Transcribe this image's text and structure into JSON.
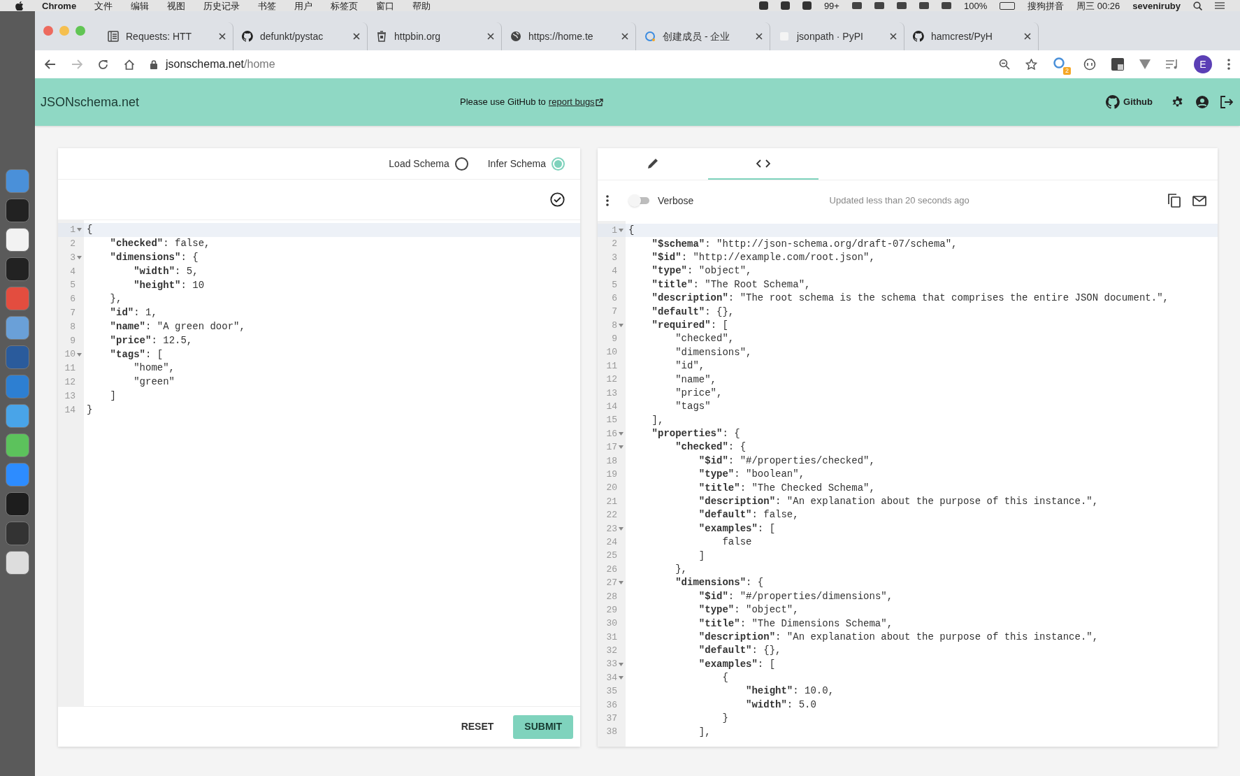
{
  "menu_bar": {
    "app": "Chrome",
    "menus": [
      "文件",
      "编辑",
      "视图",
      "历史记录",
      "书签",
      "用户",
      "标签页",
      "窗口",
      "帮助"
    ],
    "status_items": [
      "99+",
      "100%",
      "搜狗拼音",
      "周三 00:26",
      "seveniruby"
    ]
  },
  "browser": {
    "tabs": [
      {
        "title": "Requests: HTT",
        "kind": "doc",
        "selected": false
      },
      {
        "title": "defunkt/pystac",
        "kind": "github",
        "selected": false
      },
      {
        "title": "httpbin.org",
        "kind": "bin",
        "selected": false
      },
      {
        "title": "https://home.te",
        "kind": "globe",
        "selected": false
      },
      {
        "title": "创建成员 - 企业",
        "kind": "ring",
        "selected": false
      },
      {
        "title": "jsonpath · PyPI",
        "kind": "blank",
        "selected": false
      },
      {
        "title": "hamcrest/PyH",
        "kind": "github",
        "selected": false
      }
    ],
    "address": {
      "host": "jsonschema.net",
      "path": "/home"
    },
    "extension_badge": "2",
    "avatar": "E"
  },
  "app_header": {
    "brand": "JSONschema.net",
    "notice": "Please use GitHub to",
    "notice_link": "report bugs",
    "github_label": "Github"
  },
  "input_panel": {
    "options": [
      {
        "label": "Load Schema",
        "selected": false
      },
      {
        "label": "Infer Schema",
        "selected": true
      }
    ],
    "lines": [
      {
        "n": "1",
        "text": "{",
        "fold": true,
        "active": true
      },
      {
        "n": "2",
        "text": "    **\"checked\"**: false,",
        "fold": false,
        "active": false
      },
      {
        "n": "3",
        "text": "    **\"dimensions\"**: {",
        "fold": true,
        "active": false
      },
      {
        "n": "4",
        "text": "        **\"width\"**: 5,",
        "fold": false,
        "active": false
      },
      {
        "n": "5",
        "text": "        **\"height\"**: 10",
        "fold": false,
        "active": false
      },
      {
        "n": "6",
        "text": "    },",
        "fold": false,
        "active": false
      },
      {
        "n": "7",
        "text": "    **\"id\"**: 1,",
        "fold": false,
        "active": false
      },
      {
        "n": "8",
        "text": "    **\"name\"**: \"A green door\",",
        "fold": false,
        "active": false
      },
      {
        "n": "9",
        "text": "    **\"price\"**: 12.5,",
        "fold": false,
        "active": false
      },
      {
        "n": "10",
        "text": "    **\"tags\"**: [",
        "fold": true,
        "active": false
      },
      {
        "n": "11",
        "text": "        \"home\",",
        "fold": false,
        "active": false
      },
      {
        "n": "12",
        "text": "        \"green\"",
        "fold": false,
        "active": false
      },
      {
        "n": "13",
        "text": "    ]",
        "fold": false,
        "active": false
      },
      {
        "n": "14",
        "text": "}",
        "fold": false,
        "active": false
      }
    ],
    "buttons": [
      {
        "label": "RESET",
        "kind": "text"
      },
      {
        "label": "SUBMIT",
        "kind": "primary"
      }
    ]
  },
  "schema_panel": {
    "tabs": [
      {
        "kind": "edit",
        "selected": false
      },
      {
        "kind": "code",
        "selected": true
      }
    ],
    "verbose": {
      "label": "Verbose",
      "on": false
    },
    "status": "Updated less than 20 seconds ago",
    "lines": [
      {
        "n": "1",
        "text": "{",
        "fold": true,
        "active": true
      },
      {
        "n": "2",
        "text": "    **\"$schema\"**: \"http://json-schema.org/draft-07/schema\",",
        "fold": false,
        "active": false
      },
      {
        "n": "3",
        "text": "    **\"$id\"**: \"http://example.com/root.json\",",
        "fold": false,
        "active": false
      },
      {
        "n": "4",
        "text": "    **\"type\"**: \"object\",",
        "fold": false,
        "active": false
      },
      {
        "n": "5",
        "text": "    **\"title\"**: \"The Root Schema\",",
        "fold": false,
        "active": false
      },
      {
        "n": "6",
        "text": "    **\"description\"**: \"The root schema is the schema that comprises the entire JSON document.\",",
        "fold": false,
        "active": false
      },
      {
        "n": "7",
        "text": "    **\"default\"**: {},",
        "fold": false,
        "active": false
      },
      {
        "n": "8",
        "text": "    **\"required\"**: [",
        "fold": true,
        "active": false
      },
      {
        "n": "9",
        "text": "        \"checked\",",
        "fold": false,
        "active": false
      },
      {
        "n": "10",
        "text": "        \"dimensions\",",
        "fold": false,
        "active": false
      },
      {
        "n": "11",
        "text": "        \"id\",",
        "fold": false,
        "active": false
      },
      {
        "n": "12",
        "text": "        \"name\",",
        "fold": false,
        "active": false
      },
      {
        "n": "13",
        "text": "        \"price\",",
        "fold": false,
        "active": false
      },
      {
        "n": "14",
        "text": "        \"tags\"",
        "fold": false,
        "active": false
      },
      {
        "n": "15",
        "text": "    ],",
        "fold": false,
        "active": false
      },
      {
        "n": "16",
        "text": "    **\"properties\"**: {",
        "fold": true,
        "active": false
      },
      {
        "n": "17",
        "text": "        **\"checked\"**: {",
        "fold": true,
        "active": false
      },
      {
        "n": "18",
        "text": "            **\"$id\"**: \"#/properties/checked\",",
        "fold": false,
        "active": false
      },
      {
        "n": "19",
        "text": "            **\"type\"**: \"boolean\",",
        "fold": false,
        "active": false
      },
      {
        "n": "20",
        "text": "            **\"title\"**: \"The Checked Schema\",",
        "fold": false,
        "active": false
      },
      {
        "n": "21",
        "text": "            **\"description\"**: \"An explanation about the purpose of this instance.\",",
        "fold": false,
        "active": false
      },
      {
        "n": "22",
        "text": "            **\"default\"**: false,",
        "fold": false,
        "active": false
      },
      {
        "n": "23",
        "text": "            **\"examples\"**: [",
        "fold": true,
        "active": false
      },
      {
        "n": "24",
        "text": "                false",
        "fold": false,
        "active": false
      },
      {
        "n": "25",
        "text": "            ]",
        "fold": false,
        "active": false
      },
      {
        "n": "26",
        "text": "        },",
        "fold": false,
        "active": false
      },
      {
        "n": "27",
        "text": "        **\"dimensions\"**: {",
        "fold": true,
        "active": false
      },
      {
        "n": "28",
        "text": "            **\"$id\"**: \"#/properties/dimensions\",",
        "fold": false,
        "active": false
      },
      {
        "n": "29",
        "text": "            **\"type\"**: \"object\",",
        "fold": false,
        "active": false
      },
      {
        "n": "30",
        "text": "            **\"title\"**: \"The Dimensions Schema\",",
        "fold": false,
        "active": false
      },
      {
        "n": "31",
        "text": "            **\"description\"**: \"An explanation about the purpose of this instance.\",",
        "fold": false,
        "active": false
      },
      {
        "n": "32",
        "text": "            **\"default\"**: {},",
        "fold": false,
        "active": false
      },
      {
        "n": "33",
        "text": "            **\"examples\"**: [",
        "fold": true,
        "active": false
      },
      {
        "n": "34",
        "text": "                {",
        "fold": true,
        "active": false
      },
      {
        "n": "35",
        "text": "                    **\"height\"**: 10.0,",
        "fold": false,
        "active": false
      },
      {
        "n": "36",
        "text": "                    **\"width\"**: 5.0",
        "fold": false,
        "active": false
      },
      {
        "n": "37",
        "text": "                }",
        "fold": false,
        "active": false
      },
      {
        "n": "38",
        "text": "            ],",
        "fold": false,
        "active": false
      }
    ]
  }
}
